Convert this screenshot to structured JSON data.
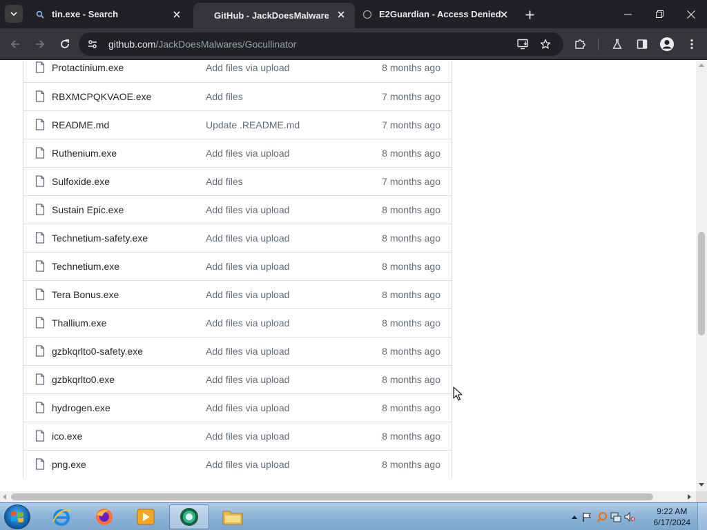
{
  "browser": {
    "tabs": [
      {
        "title": "tin.exe - Search",
        "active": false,
        "icon": "search-favicon"
      },
      {
        "title": "GitHub - JackDoesMalwares/G",
        "active": true,
        "icon": "none"
      },
      {
        "title": "E2Guardian - Access Denied",
        "active": false,
        "icon": "globe-favicon"
      }
    ],
    "url_host": "github.com",
    "url_path": "/JackDoesMalwares/Gocullinator"
  },
  "files": [
    {
      "name": "Protactinium.exe",
      "commit": "Add files via upload",
      "age": "8 months ago"
    },
    {
      "name": "RBXMCPQKVAOE.exe",
      "commit": "Add files",
      "age": "7 months ago"
    },
    {
      "name": "README.md",
      "commit": "Update .README.md",
      "age": "7 months ago"
    },
    {
      "name": "Ruthenium.exe",
      "commit": "Add files via upload",
      "age": "8 months ago"
    },
    {
      "name": "Sulfoxide.exe",
      "commit": "Add files",
      "age": "7 months ago"
    },
    {
      "name": "Sustain Epic.exe",
      "commit": "Add files via upload",
      "age": "8 months ago"
    },
    {
      "name": "Technetium-safety.exe",
      "commit": "Add files via upload",
      "age": "8 months ago"
    },
    {
      "name": "Technetium.exe",
      "commit": "Add files via upload",
      "age": "8 months ago"
    },
    {
      "name": "Tera Bonus.exe",
      "commit": "Add files via upload",
      "age": "8 months ago"
    },
    {
      "name": "Thallium.exe",
      "commit": "Add files via upload",
      "age": "8 months ago"
    },
    {
      "name": "gzbkqrlto0-safety.exe",
      "commit": "Add files via upload",
      "age": "8 months ago"
    },
    {
      "name": "gzbkqrlto0.exe",
      "commit": "Add files via upload",
      "age": "8 months ago"
    },
    {
      "name": "hydrogen.exe",
      "commit": "Add files via upload",
      "age": "8 months ago"
    },
    {
      "name": "ico.exe",
      "commit": "Add files via upload",
      "age": "8 months ago"
    },
    {
      "name": "png.exe",
      "commit": "Add files via upload",
      "age": "8 months ago"
    }
  ],
  "taskbar": {
    "apps": [
      "internet-explorer-icon",
      "firefox-icon",
      "media-player-icon",
      "chrome-canary-icon",
      "file-explorer-icon"
    ],
    "time": "9:22 AM",
    "date": "6/17/2024"
  },
  "colors": {
    "chrome_dark": "#202124",
    "chrome_toolbar": "#35363a",
    "text_primary": "#1f2328",
    "text_muted": "#636c76",
    "taskbar": "#8db3d6"
  }
}
